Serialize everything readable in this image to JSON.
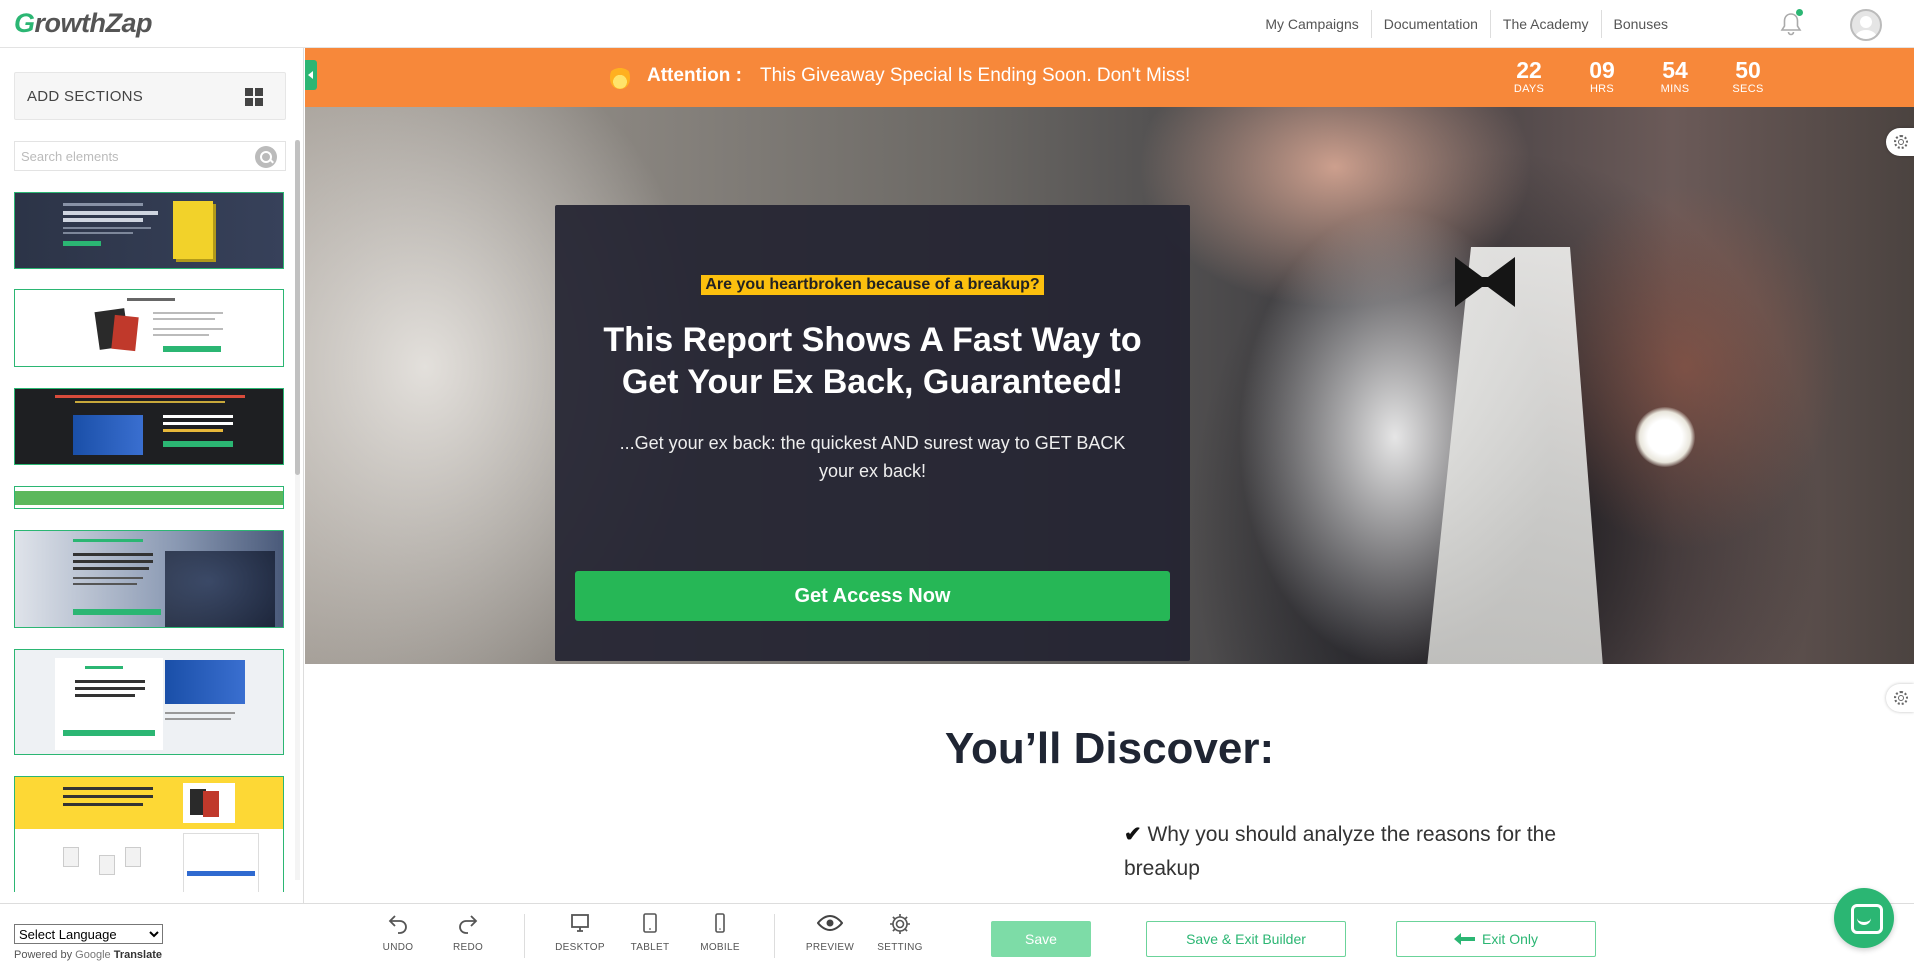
{
  "topbar": {
    "logo_first_letter": "G",
    "logo_rest": "rowthZap",
    "nav": [
      "My Campaigns",
      "Documentation",
      "The Academy",
      "Bonuses"
    ]
  },
  "sidebar": {
    "add_sections_label": "ADD SECTIONS",
    "search_placeholder": "Search elements",
    "thumbnails": [
      {
        "name": "section-template-1"
      },
      {
        "name": "section-template-2"
      },
      {
        "name": "section-template-3"
      },
      {
        "name": "section-template-4"
      },
      {
        "name": "section-template-5"
      },
      {
        "name": "section-template-6"
      },
      {
        "name": "section-template-7"
      }
    ]
  },
  "attention_bar": {
    "title": "Attention :",
    "message": "This Giveaway Special Is Ending Soon. Don't Miss!",
    "countdown": [
      {
        "value": "22",
        "unit": "DAYS"
      },
      {
        "value": "09",
        "unit": "HRS"
      },
      {
        "value": "54",
        "unit": "MINS"
      },
      {
        "value": "50",
        "unit": "SECS"
      }
    ]
  },
  "hero": {
    "kicker": "Are you heartbroken because of a breakup?",
    "title": "This Report Shows A Fast Way to Get Your Ex Back, Guaranteed!",
    "subtitle": "...Get your ex back: the quickest AND surest way to GET BACK your ex back!",
    "cta": "Get Access Now"
  },
  "discover": {
    "heading": "You’ll Discover:",
    "bullet_check": "✔",
    "bullet_text": "Why you should analyze the reasons for the breakup"
  },
  "bottombar": {
    "language_select": "Select Language",
    "powered_by": "Powered by",
    "google": "Google",
    "translate": "Translate",
    "tools": [
      {
        "label": "UNDO",
        "icon": "undo-icon"
      },
      {
        "label": "REDO",
        "icon": "redo-icon"
      },
      {
        "label": "DESKTOP",
        "icon": "desktop-icon"
      },
      {
        "label": "TABLET",
        "icon": "tablet-icon"
      },
      {
        "label": "MOBILE",
        "icon": "mobile-icon"
      },
      {
        "label": "PREVIEW",
        "icon": "eye-icon"
      },
      {
        "label": "SETTING",
        "icon": "gear-icon"
      }
    ],
    "save": "Save",
    "save_exit": "Save & Exit Builder",
    "exit_only": "Exit Only"
  },
  "colors": {
    "brand_green": "#2bb673",
    "attention_orange": "#f7883a",
    "kicker_yellow": "#fcc00e",
    "cta_green": "#26b756",
    "card_bg": "#232432"
  }
}
